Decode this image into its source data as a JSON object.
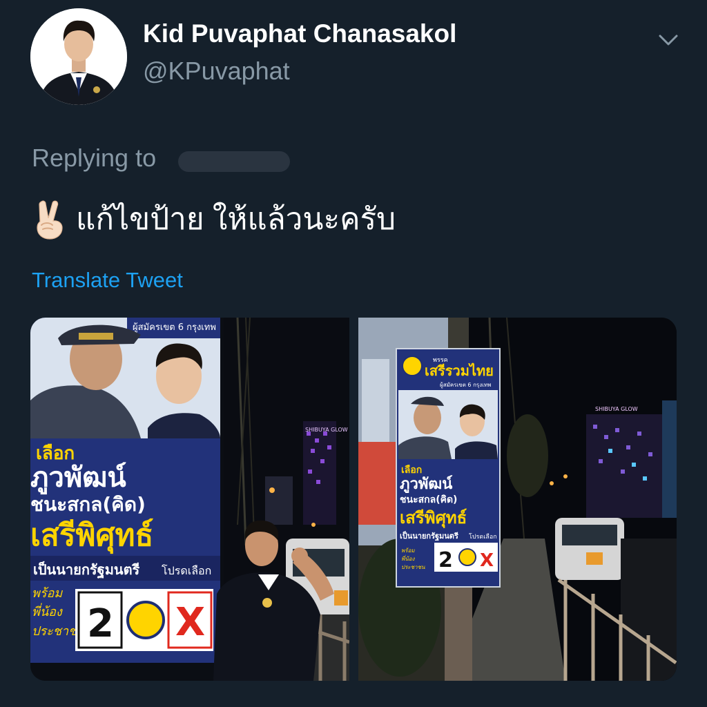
{
  "author": {
    "display_name": "Kid Puvaphat Chanasakol",
    "handle": "@KPuvaphat"
  },
  "reply": {
    "prefix": "Replying to"
  },
  "tweet": {
    "text": "แก้ไขป้าย ให้แล้วนะครับ",
    "emoji": "victory-hand-emoji"
  },
  "actions": {
    "translate": "Translate Tweet"
  },
  "poster": {
    "party_small": "พรรค",
    "party_name": "เสรีรวมไทย",
    "district": "ผู้สมัครเขต 6 กรุงเทพ",
    "choose": "เลือก",
    "candidate_first": "ภูวพัฒน์",
    "candidate_last": "ชนะสกล(คิด)",
    "leader": "เสรีพิศุทธ์",
    "pm_line": "เป็นนายกรัฐมนตรี",
    "please_vote": "โปรดเลือก",
    "number": "2",
    "mark": "X",
    "slogan_1": "พร้อม",
    "slogan_2": "พี่น้อง",
    "slogan_3": "ประชาชน"
  },
  "signage": {
    "building": "SHIBUYA GLOW"
  },
  "colors": {
    "background": "#15202b",
    "primary_text": "#ffffff",
    "secondary_text": "#8899a6",
    "link": "#1da1f2",
    "poster_navy": "#1f2f73",
    "poster_yellow": "#ffd400",
    "mark_red": "#e0281e"
  }
}
